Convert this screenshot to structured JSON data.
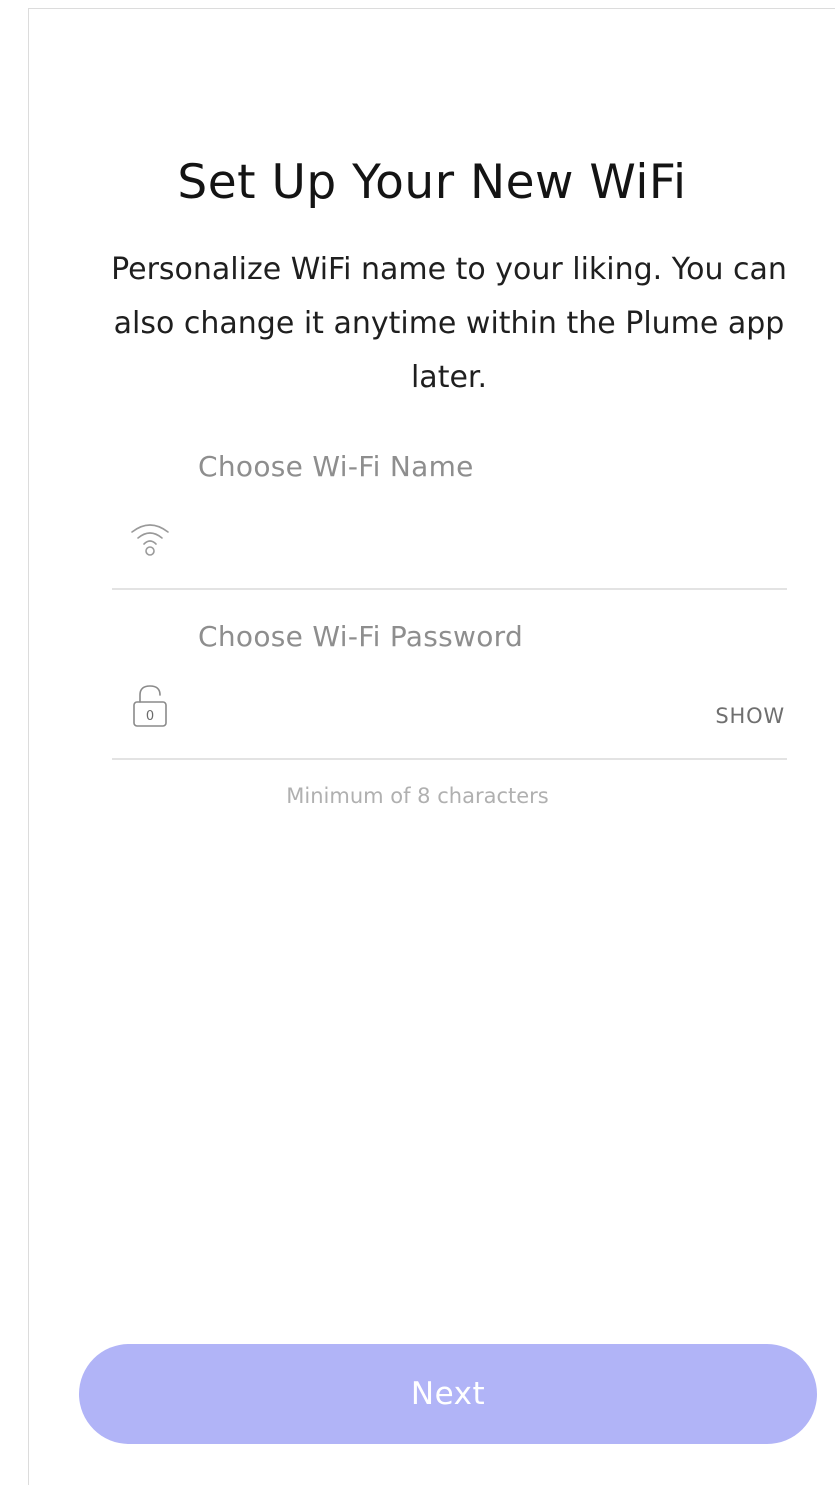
{
  "page": {
    "title": "Set Up Your New WiFi",
    "subtitle": "Personalize WiFi name to your liking. You can also change it anytime within the Plume app later."
  },
  "form": {
    "wifi_name": {
      "label": "Choose Wi-Fi Name",
      "value": "",
      "icon": "wifi-icon"
    },
    "wifi_password": {
      "label": "Choose Wi-Fi Password",
      "value": "",
      "icon": "lock-icon",
      "lock_digit": "0",
      "toggle_label": "SHOW"
    },
    "hint": "Minimum of 8 characters"
  },
  "actions": {
    "next_label": "Next"
  },
  "colors": {
    "button": "#b1b4f7",
    "label": "#8e8e8e",
    "divider": "#e3e3e3"
  }
}
